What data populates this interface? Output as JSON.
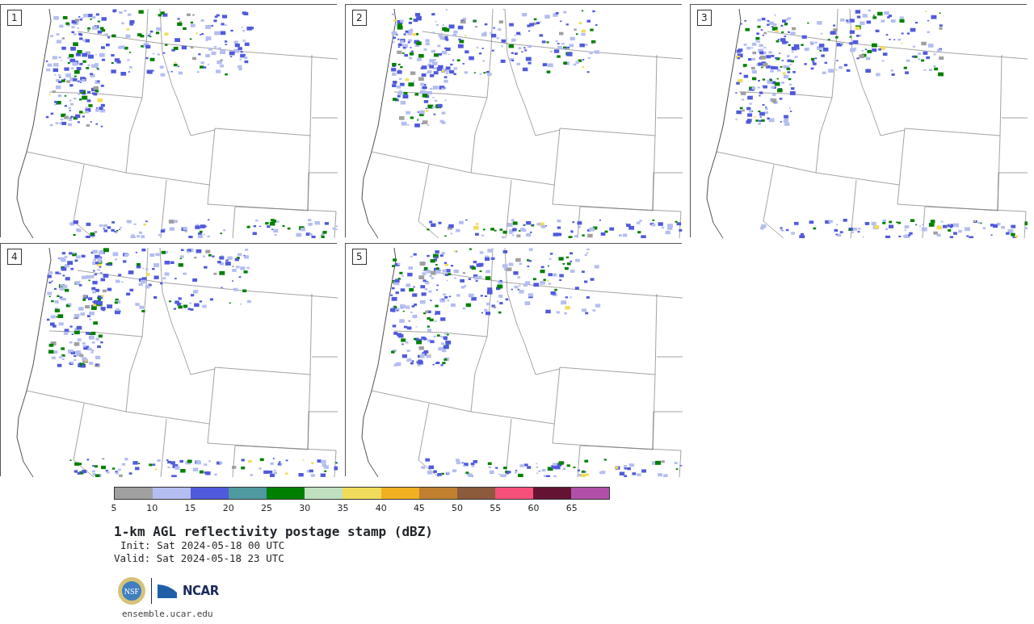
{
  "panels": [
    {
      "label": "1"
    },
    {
      "label": "2"
    },
    {
      "label": "3"
    },
    {
      "label": "4"
    },
    {
      "label": "5"
    }
  ],
  "colorbar": {
    "bins": [
      {
        "color": "#a0a0a0"
      },
      {
        "color": "#b4bef0"
      },
      {
        "color": "#505adc"
      },
      {
        "color": "#4e9aa0"
      },
      {
        "color": "#008000"
      },
      {
        "color": "#c0e0c0"
      },
      {
        "color": "#f0dc5a"
      },
      {
        "color": "#f0b020"
      },
      {
        "color": "#c08030"
      },
      {
        "color": "#8c5a3c"
      },
      {
        "color": "#f5507a"
      },
      {
        "color": "#641432"
      },
      {
        "color": "#b050a8"
      }
    ],
    "tick_labels": [
      "5",
      "10",
      "15",
      "20",
      "25",
      "30",
      "35",
      "40",
      "45",
      "50",
      "55",
      "60",
      "65"
    ]
  },
  "title": "1-km AGL reflectivity postage stamp (dBZ)",
  "init": "Init: Sat 2024-05-18 00 UTC",
  "valid": "Valid: Sat 2024-05-18 23 UTC",
  "logos": {
    "nsf": "NSF",
    "ncar": "NCAR"
  },
  "footer_link": "ensemble.ucar.edu"
}
